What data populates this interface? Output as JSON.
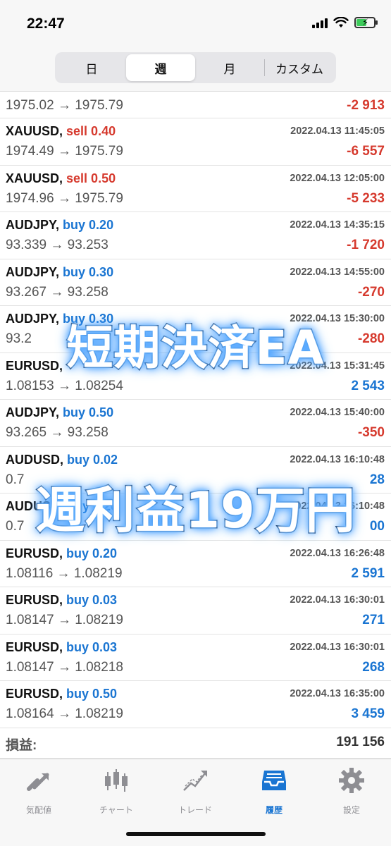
{
  "status": {
    "time": "22:47"
  },
  "periods": {
    "day": "日",
    "week": "週",
    "month": "月",
    "custom": "カスタム"
  },
  "trades": [
    {
      "prices": "1975.02 → 1975.79",
      "profit": "-2 913",
      "sign": "neg"
    },
    {
      "symbol": "XAUUSD,",
      "side": "sell 0.40",
      "side_type": "sell",
      "date": "2022.04.13 11:45:05",
      "prices": "1974.49 → 1975.79",
      "profit": "-6 557",
      "sign": "neg"
    },
    {
      "symbol": "XAUUSD,",
      "side": "sell 0.50",
      "side_type": "sell",
      "date": "2022.04.13 12:05:00",
      "prices": "1974.96 → 1975.79",
      "profit": "-5 233",
      "sign": "neg"
    },
    {
      "symbol": "AUDJPY,",
      "side": "buy 0.20",
      "side_type": "buy",
      "date": "2022.04.13 14:35:15",
      "prices": "93.339 → 93.253",
      "profit": "-1 720",
      "sign": "neg"
    },
    {
      "symbol": "AUDJPY,",
      "side": "buy 0.30",
      "side_type": "buy",
      "date": "2022.04.13 14:55:00",
      "prices": "93.267 → 93.258",
      "profit": "-270",
      "sign": "neg"
    },
    {
      "symbol": "AUDJPY,",
      "side": "buy 0.30",
      "side_type": "buy",
      "date": "2022.04.13 15:30:00",
      "prices": "93.2",
      "profit": "-280",
      "sign": "neg"
    },
    {
      "symbol": "EURUSD,",
      "side": "",
      "side_type": "buy",
      "date": "2022.04.13 15:31:45",
      "prices": "1.08153 → 1.08254",
      "profit": "2 543",
      "sign": "pos"
    },
    {
      "symbol": "AUDJPY,",
      "side": "buy 0.50",
      "side_type": "buy",
      "date": "2022.04.13 15:40:00",
      "prices": "93.265 → 93.258",
      "profit": "-350",
      "sign": "neg"
    },
    {
      "symbol": "AUDUSD,",
      "side": "buy 0.02",
      "side_type": "buy",
      "date": "2022.04.13 16:10:48",
      "prices": "0.7",
      "profit": "28",
      "sign": "pos"
    },
    {
      "symbol": "AUDUSD,",
      "side": "buy 0.20",
      "side_type": "buy",
      "date": "2022.04.13 16:10:48",
      "prices": "0.7",
      "profit": "00",
      "sign": "pos"
    },
    {
      "symbol": "EURUSD,",
      "side": "buy 0.20",
      "side_type": "buy",
      "date": "2022.04.13 16:26:48",
      "prices": "1.08116 → 1.08219",
      "profit": "2 591",
      "sign": "pos"
    },
    {
      "symbol": "EURUSD,",
      "side": "buy 0.03",
      "side_type": "buy",
      "date": "2022.04.13 16:30:01",
      "prices": "1.08147 → 1.08219",
      "profit": "271",
      "sign": "pos"
    },
    {
      "symbol": "EURUSD,",
      "side": "buy 0.03",
      "side_type": "buy",
      "date": "2022.04.13 16:30:01",
      "prices": "1.08147 → 1.08218",
      "profit": "268",
      "sign": "pos"
    },
    {
      "symbol": "EURUSD,",
      "side": "buy 0.50",
      "side_type": "buy",
      "date": "2022.04.13 16:35:00",
      "prices": "1.08164 → 1.08219",
      "profit": "3 459",
      "sign": "pos"
    }
  ],
  "total": {
    "label": "損益:",
    "value": "191 156"
  },
  "overlay": {
    "line1": "短期決済EA",
    "line2": "週利益19万円"
  },
  "tabs": [
    {
      "label": "気配値",
      "icon": "quotes-arrows-icon"
    },
    {
      "label": "チャート",
      "icon": "candlestick-chart-icon"
    },
    {
      "label": "トレード",
      "icon": "trade-line-icon"
    },
    {
      "label": "履歴",
      "icon": "history-inbox-icon",
      "active": true
    },
    {
      "label": "設定",
      "icon": "gear-icon"
    }
  ],
  "colors": {
    "loss": "#d63a2e",
    "gain": "#1a75d2",
    "active_tab": "#1a75d2",
    "inactive_tab": "#8e8e93"
  }
}
